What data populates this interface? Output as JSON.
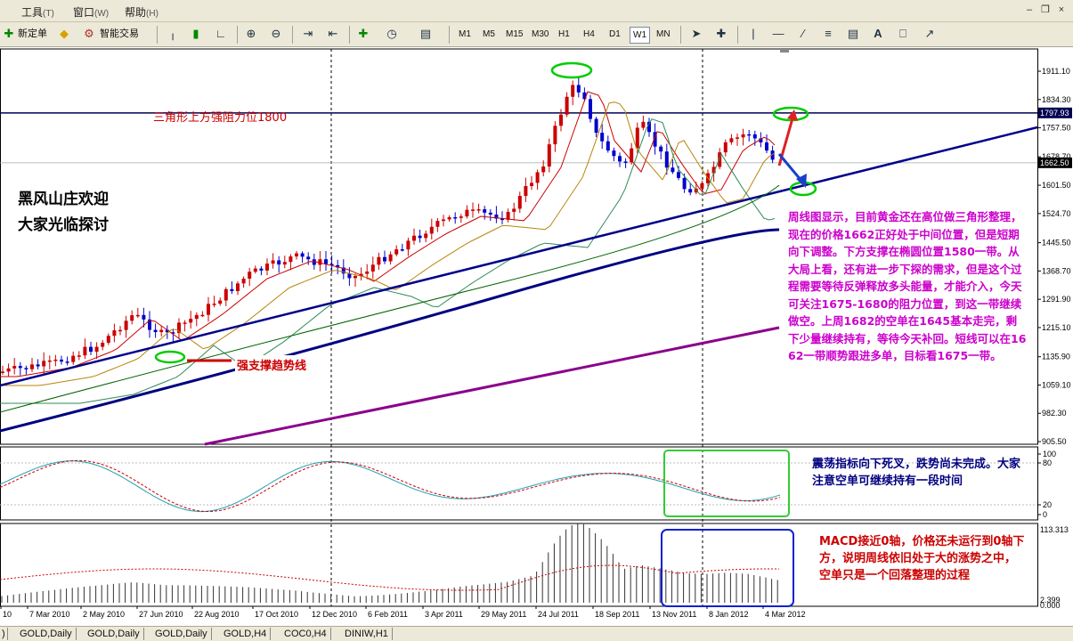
{
  "menu": {
    "items": [
      {
        "label": "工具",
        "key": "(T)"
      },
      {
        "label": "窗口",
        "key": "(W)"
      },
      {
        "label": "帮助",
        "key": "(H)"
      }
    ]
  },
  "toolbar": {
    "new_order": "新定单",
    "expert_advisors": "智能交易",
    "timeframes": [
      "M1",
      "M5",
      "M15",
      "M30",
      "H1",
      "H4",
      "D1",
      "W1",
      "MN"
    ],
    "active_timeframe": "W1"
  },
  "price_axis": {
    "ticks": [
      "1911.10",
      "1834.30",
      "1757.50",
      "1678.70",
      "1601.50",
      "1524.70",
      "1445.50",
      "1368.70",
      "1291.90",
      "1215.10",
      "1135.90",
      "1059.10",
      "982.30",
      "905.50"
    ],
    "resistance_label": "1797.93",
    "current_label": "1662.50"
  },
  "stoch_axis": {
    "ticks": [
      "100",
      "80",
      "20",
      "0"
    ]
  },
  "macd_axis": {
    "top": "113.313",
    "bottom": "0.000",
    "bottom2": "2.399"
  },
  "date_axis": {
    "labels": [
      "10",
      "7 Mar 2010",
      "2 May 2010",
      "27 Jun 2010",
      "22 Aug 2010",
      "17 Oct 2010",
      "12 Dec 2010",
      "6 Feb 2011",
      "3 Apr 2011",
      "29 May 2011",
      "24 Jul 2011",
      "18 Sep 2011",
      "13 Nov 2011",
      "8 Jan 2012",
      "4 Mar 2012"
    ]
  },
  "annotations": {
    "resistance": "三角形上方强阻力位1800",
    "welcome_line1": "黑风山庄欢迎",
    "welcome_line2": "大家光临探讨",
    "support": "强支撑趋势线",
    "analysis": "周线图显示，目前黄金还在高位做三角形整理，现在的价格1662正好处于中间位置，但是短期向下调整。下方支撑在椭圆位置1580一带。从大局上看，还有进一步下探的需求，但是这个过程需要等待反弹释放多头能量，才能介入，今天可关注1675-1680的阻力位置，到这一带继续做空。上周1682的空单在1645基本走完，剩下少量继续持有，等待今天补回。短线可以在1662一带顺势跟进多单，目标看1675一带。",
    "stochastic": "震荡指标向下死叉，跌势尚未完成。大家注意空单可继续持有一段时间",
    "macd": "MACD接近0轴，价格还未运行到0轴下方，说明周线依旧处于大的涨势之中，空单只是一个回落整理的过程"
  },
  "tabs": [
    "GOLD,Daily",
    "GOLD,Daily",
    "GOLD,Daily",
    "GOLD,H4",
    "COC0,H4",
    "DINIW,H1"
  ],
  "colors": {
    "bull_candle": "#cc0000",
    "bear_candle": "#0000cc",
    "trendline": "#00008b",
    "resistance_line": "#000050",
    "ellipse": "#00cc00",
    "red_text": "#cc0000",
    "magenta_text": "#cc00cc",
    "navy_text": "#000080"
  }
}
